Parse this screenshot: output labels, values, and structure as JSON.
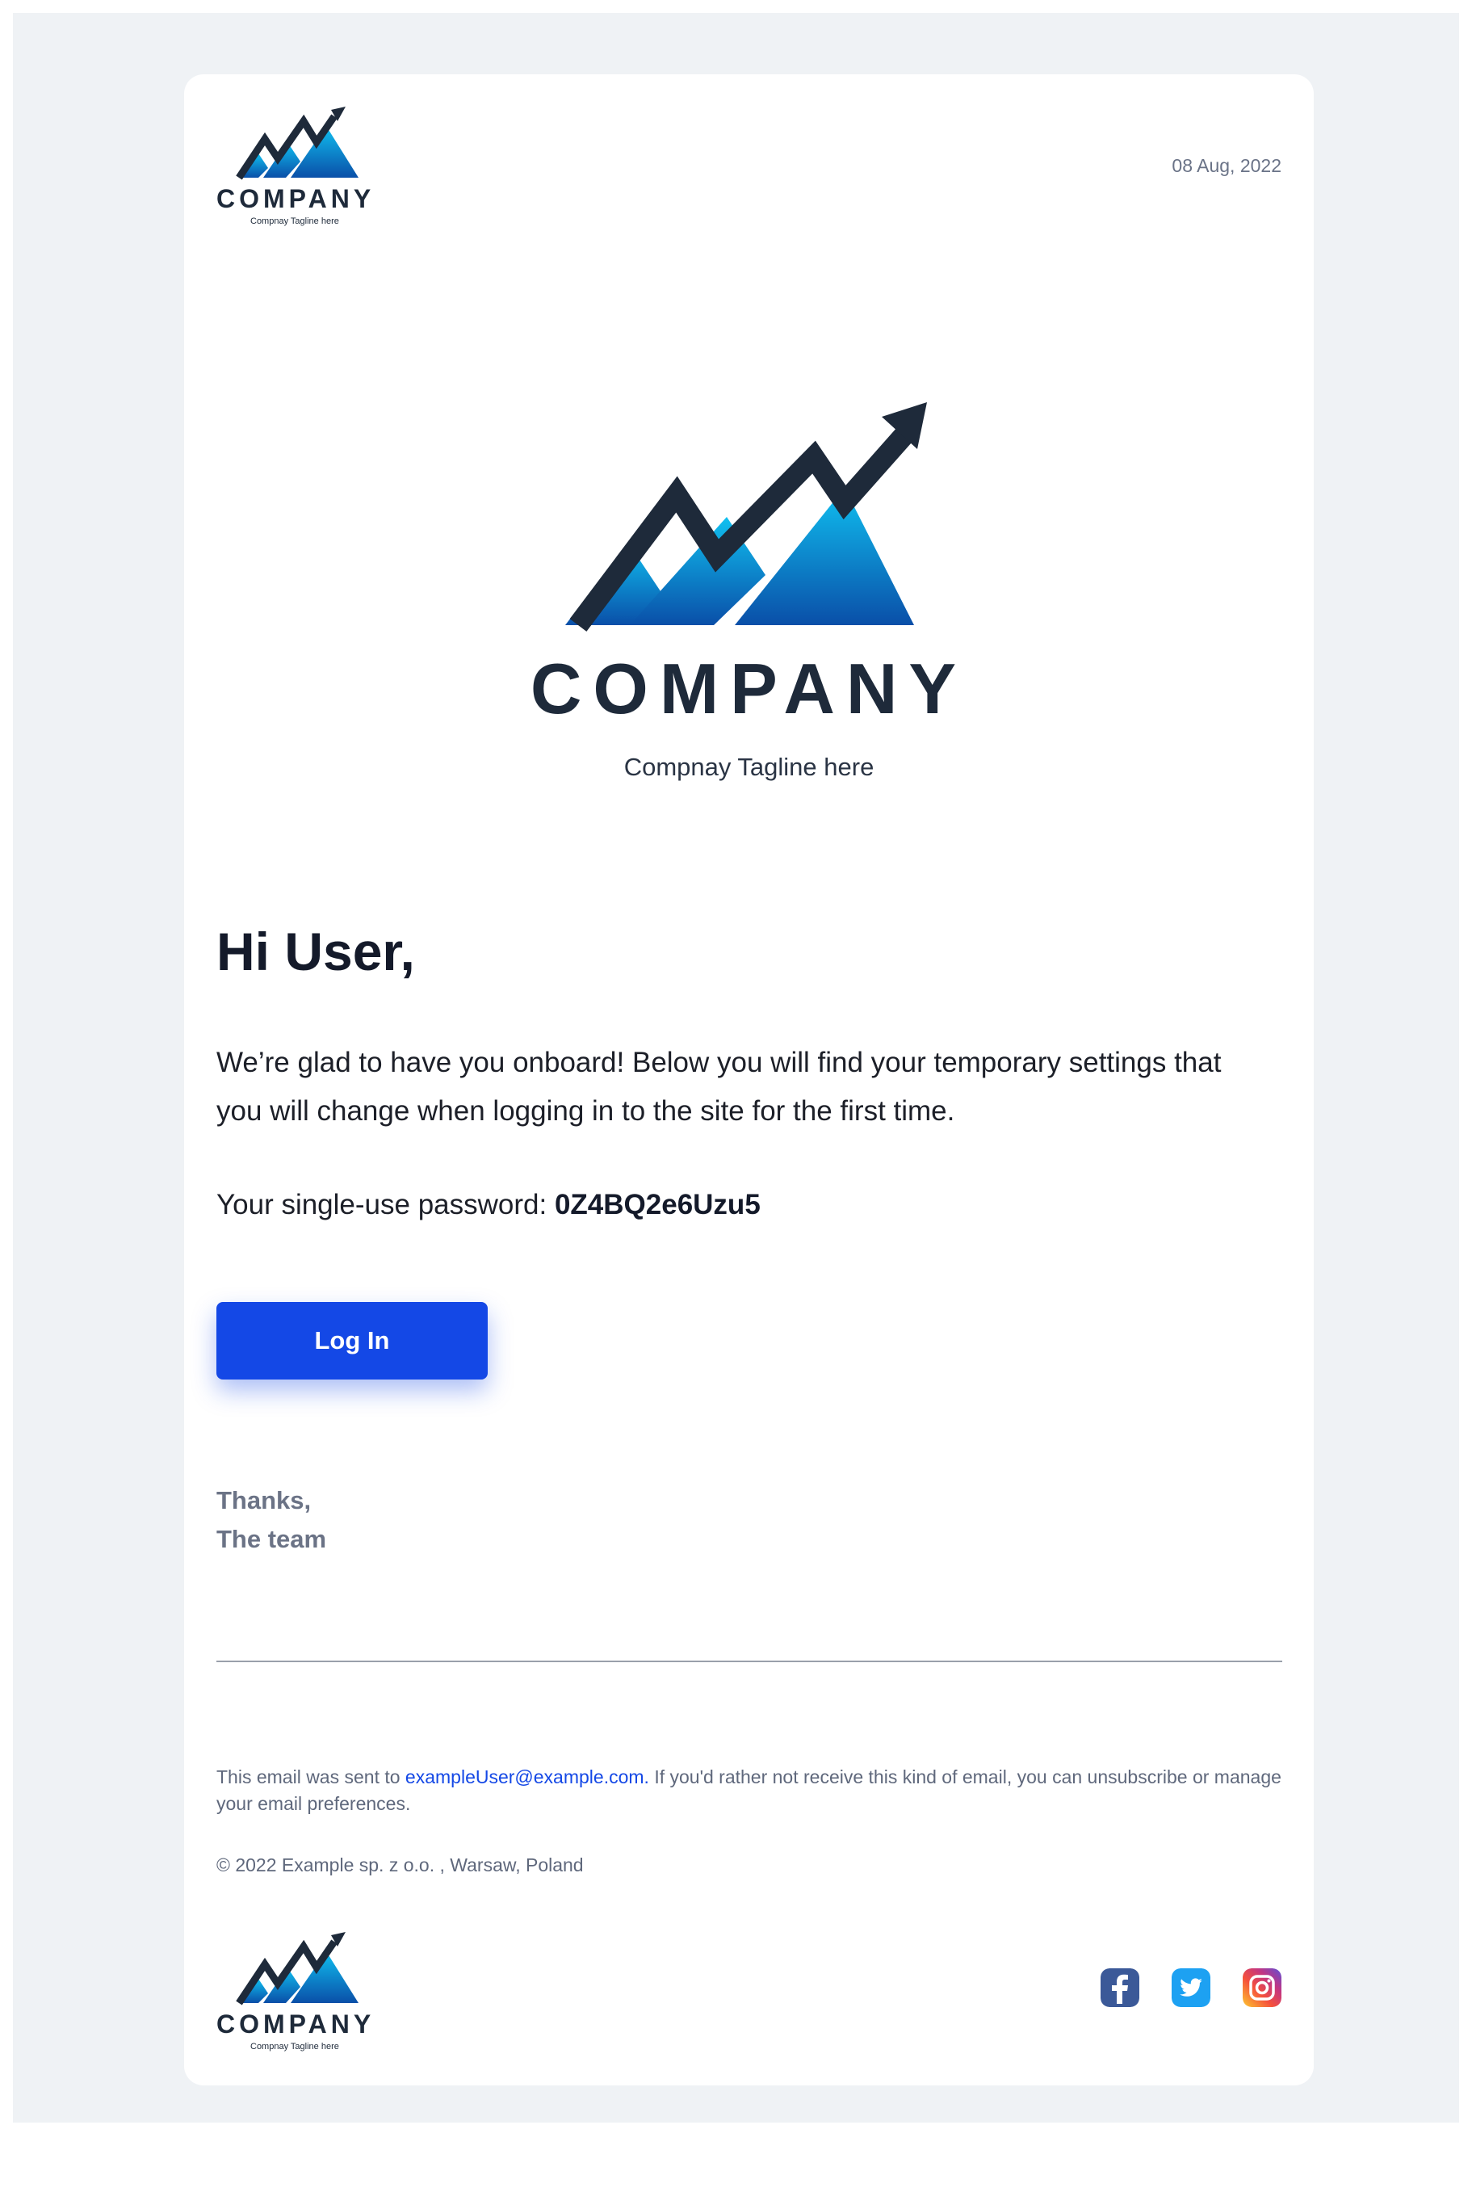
{
  "brand": {
    "wordmark": "COMPANY",
    "tagline": "Compnay Tagline here"
  },
  "header": {
    "date": "08 Aug, 2022"
  },
  "message": {
    "greeting": "Hi User,",
    "intro": "We’re glad to have you onboard! Below you will find your temporary settings that you will change when logging in to the site for the first time.",
    "password_label": "Your single-use password:",
    "password_value": "0Z4BQ2e6Uzu5",
    "login_label": "Log In",
    "thanks": "Thanks,",
    "team": "The team"
  },
  "footer": {
    "sent_to_prefix": "This email was sent to",
    "email": "exampleUser@example.com.",
    "sent_to_suffix": "If you'd rather not receive this kind of email, you can unsubscribe or manage your email preferences.",
    "copyright": "© 2022 Example sp. z o.o. , Warsaw, Poland"
  },
  "socials": [
    {
      "name": "facebook-icon",
      "color": "#3b5998"
    },
    {
      "name": "twitter-icon",
      "color": "#1da1f2"
    },
    {
      "name": "instagram-icon",
      "color": "#c13584"
    }
  ],
  "colors": {
    "background": "#eff2f5",
    "card": "#ffffff",
    "accent": "#1448e6",
    "dark": "#1e2a3a",
    "logo_gradient_top": "#10c0f0",
    "logo_gradient_bottom": "#0a4fa8"
  }
}
